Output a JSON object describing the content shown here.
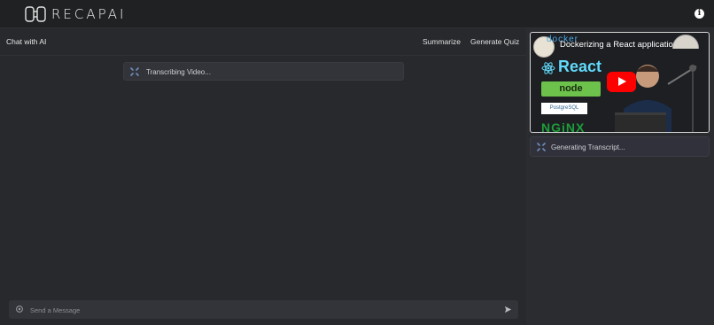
{
  "app": {
    "brand": "RECAPAI",
    "info_icon": "info-icon"
  },
  "chat": {
    "title": "Chat with AI",
    "actions": [
      "Summarize",
      "Generate Quiz"
    ],
    "status": "Transcribing Video...",
    "input_placeholder": "Send a Message",
    "input_value": ""
  },
  "sidebar": {
    "video_title": "Dockerizing a React applicatio...",
    "video_logos": [
      "docker",
      "React",
      "node",
      "PostgreSQL",
      "NGiNX"
    ],
    "transcript_status": "Generating Transcript..."
  },
  "colors": {
    "accent_spinner": "#6f8fbf",
    "play_button": "#ff0000",
    "background": "#25262a"
  }
}
